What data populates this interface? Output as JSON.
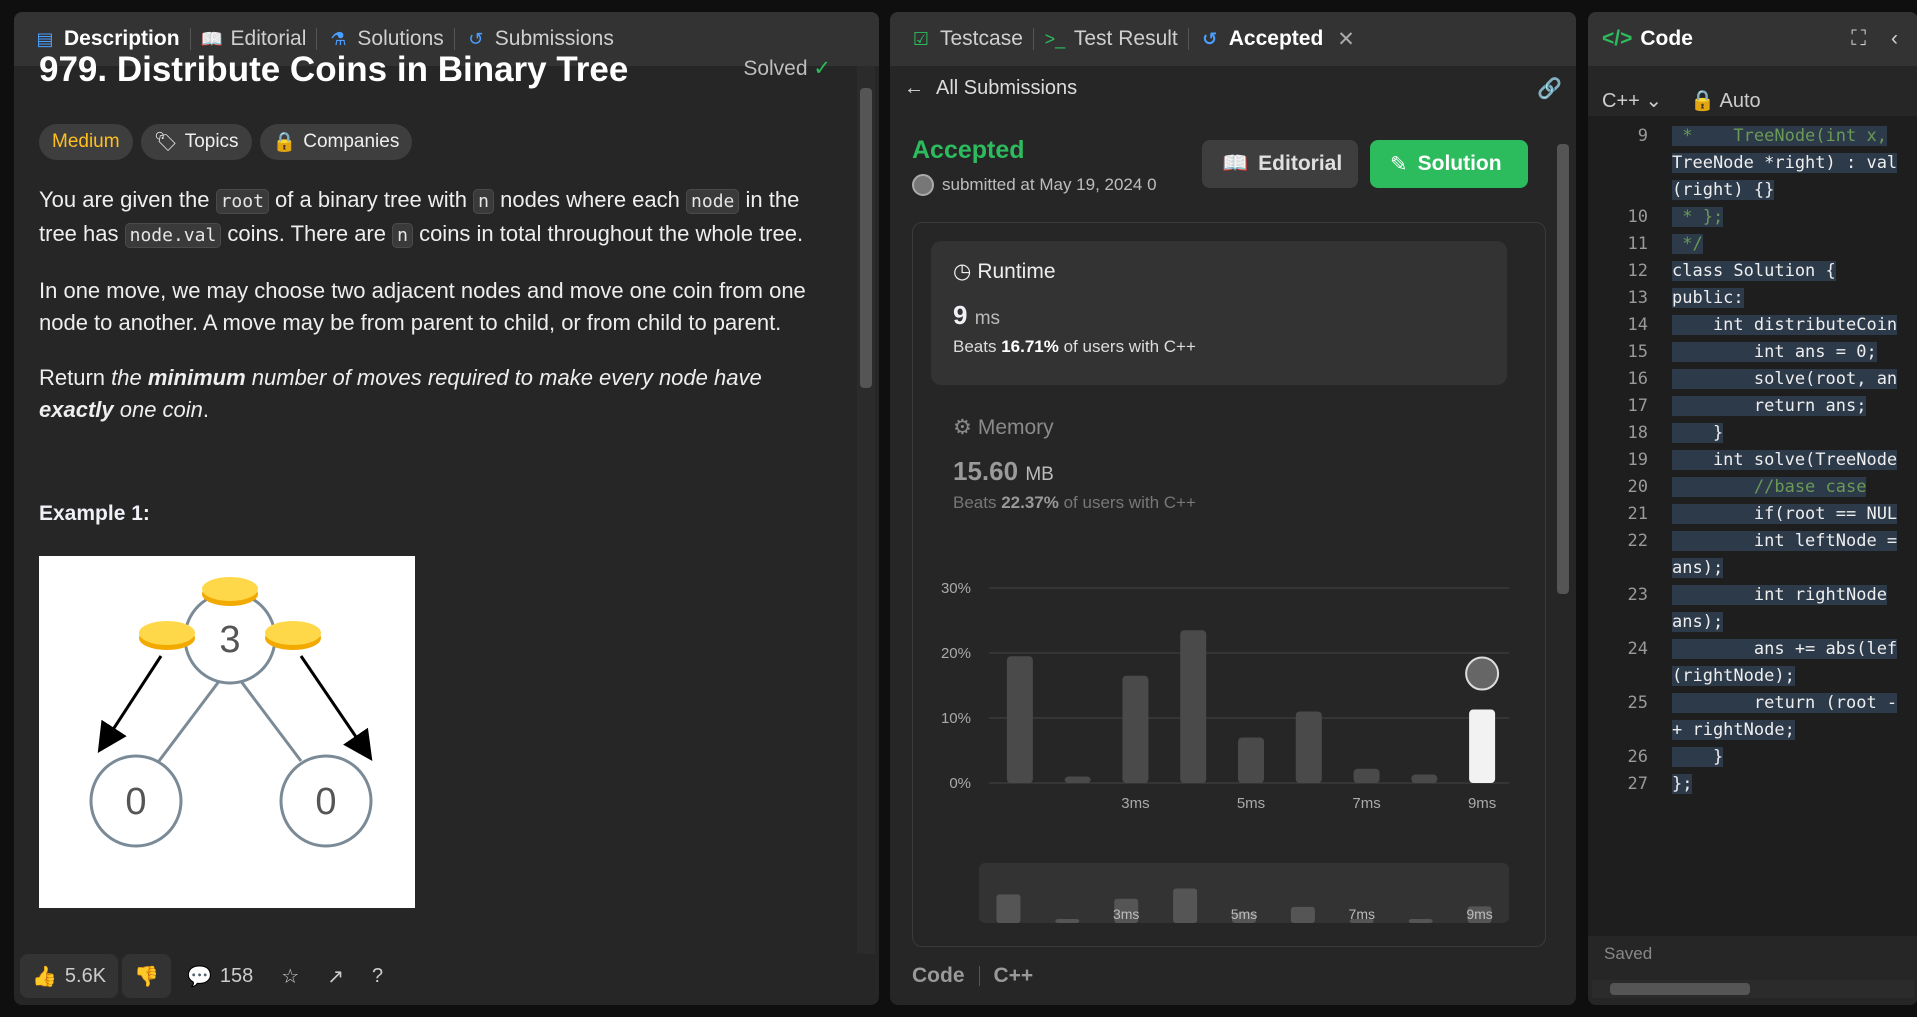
{
  "left": {
    "tabs": [
      "Description",
      "Editorial",
      "Solutions",
      "Submissions"
    ],
    "title": "979. Distribute Coins in Binary Tree",
    "solved": "Solved",
    "badges": {
      "difficulty": "Medium",
      "topics": "Topics",
      "companies": "Companies"
    },
    "desc": {
      "p1a": "You are given the ",
      "code_root": "root",
      "p1b": " of a binary tree with ",
      "code_n": "n",
      "p1c": " nodes where each ",
      "code_node": "node",
      "p1d": " in the tree has ",
      "code_nodeval": "node.val",
      "p1e": " coins. There are ",
      "code_n2": "n",
      "p1f": " coins in total throughout the whole tree.",
      "p2": "In one move, we may choose two adjacent nodes and move one coin from one node to another. A move may be from parent to child, or from child to parent.",
      "p3a": "Return ",
      "p3b": "the ",
      "p3c": "minimum",
      "p3d": " number of moves required to make every node have ",
      "p3e": "exactly",
      "p3f": " one coin",
      "p3g": "."
    },
    "example_label": "Example 1:",
    "tree": {
      "root": "3",
      "left": "0",
      "right": "0"
    },
    "footer": {
      "likes": "5.6K",
      "comments": "158"
    }
  },
  "middle": {
    "tabs": [
      "Testcase",
      "Test Result",
      "Accepted"
    ],
    "back_label": "All Submissions",
    "status": "Accepted",
    "submitted": "submitted at May 19, 2024 0",
    "editorial_btn": "Editorial",
    "solution_btn": "Solution",
    "runtime": {
      "label": "Runtime",
      "value": "9",
      "unit": "ms",
      "beats_prefix": "Beats ",
      "beats_pct": "16.71%",
      "beats_suffix": " of users with C++"
    },
    "memory": {
      "label": "Memory",
      "value": "15.60",
      "unit": "MB",
      "beats_prefix": "Beats ",
      "beats_pct": "22.37%",
      "beats_suffix": " of users with C++"
    },
    "footer": {
      "code": "Code",
      "lang": "C++"
    }
  },
  "chart_data": {
    "type": "bar",
    "yticks": [
      "30%",
      "20%",
      "10%",
      "0%"
    ],
    "ylim": [
      0,
      30
    ],
    "xticks": [
      "3ms",
      "5ms",
      "7ms",
      "9ms"
    ],
    "values": [
      19.5,
      1,
      16.5,
      23.5,
      7,
      11,
      2.2,
      1.3,
      11.3
    ],
    "highlight_index": 8,
    "colors": {
      "bar": "#4a4a4a",
      "highlight": "#f2f2f2"
    }
  },
  "right": {
    "title": "Code",
    "lang": "C++",
    "auto": "Auto",
    "saved": "Saved",
    "lines": [
      {
        "n": "9",
        "t": " *    TreeNode(int x,"
      },
      {
        "n": "",
        "t": "TreeNode *right) : val"
      },
      {
        "n": "",
        "t": "(right) {}"
      },
      {
        "n": "10",
        "t": " * };"
      },
      {
        "n": "11",
        "t": " */"
      },
      {
        "n": "12",
        "t": "class Solution {"
      },
      {
        "n": "13",
        "t": "public:"
      },
      {
        "n": "14",
        "t": "    int distributeCoin"
      },
      {
        "n": "15",
        "t": "        int ans = 0;"
      },
      {
        "n": "16",
        "t": "        solve(root, an"
      },
      {
        "n": "17",
        "t": "        return ans;"
      },
      {
        "n": "18",
        "t": "    }"
      },
      {
        "n": "19",
        "t": "    int solve(TreeNode"
      },
      {
        "n": "20",
        "t": "        //base case"
      },
      {
        "n": "21",
        "t": "        if(root == NUL"
      },
      {
        "n": "22",
        "t": "        int leftNode ="
      },
      {
        "n": "",
        "t": "ans);"
      },
      {
        "n": "23",
        "t": "        int rightNode"
      },
      {
        "n": "",
        "t": "ans);"
      },
      {
        "n": "24",
        "t": "        ans += abs(lef"
      },
      {
        "n": "",
        "t": "(rightNode);"
      },
      {
        "n": "25",
        "t": "        return (root -"
      },
      {
        "n": "",
        "t": "+ rightNode;"
      },
      {
        "n": "26",
        "t": "    }"
      },
      {
        "n": "27",
        "t": "};"
      }
    ]
  }
}
